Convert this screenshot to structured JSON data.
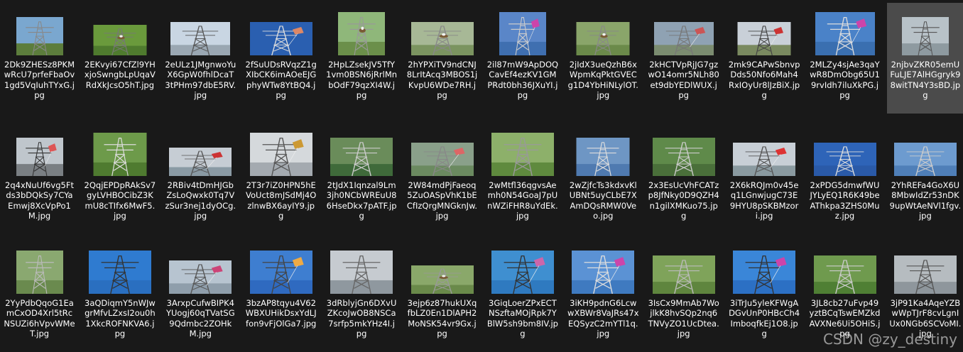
{
  "selected_index": 11,
  "files": [
    {
      "name": "2Dk9ZHESz8PKMwRcU7prfeFbaOv1gd5VqIuhTYxG.jpg",
      "thumb": {
        "sky": "#7aa7cf",
        "ground": "#5c7d3c",
        "tower": "#888",
        "w": 0.75,
        "h": 0.75
      }
    },
    {
      "name": "2EKvyi67CfZl9YHxjoSwngbLpUqaVRdXkJcsO5hT.jpg",
      "thumb": {
        "sky": "#6a9a3c",
        "ground": "#4f7b2e",
        "tower": "#777",
        "nest": true,
        "w": 0.85,
        "h": 0.6
      }
    },
    {
      "name": "2eULz1JMgnwoYuX6GpW0fhlDcaT3tPHm97dbE5RV.jpg",
      "thumb": {
        "sky": "#c9d6e3",
        "ground": "#9aa7b2",
        "tower": "#555",
        "w": 0.95,
        "h": 0.65
      }
    },
    {
      "name": "2fSuUDsRVqzZ1gXIbCK6imAOeEJGphyWTw8YtBQ4.jpg",
      "thumb": {
        "sky": "#2a5fb0",
        "ground": "#2a5fb0",
        "tower": "#ddd",
        "kite": "#d86",
        "w": 1.0,
        "h": 0.65
      }
    },
    {
      "name": "2HpLZsekJV5TfY1vm0BSN6jRrlMnbOdF79qzXI4W.jpg",
      "thumb": {
        "sky": "#8fb77a",
        "ground": "#6b8f4a",
        "tower": "#999",
        "nest": true,
        "w": 0.75,
        "h": 0.85
      }
    },
    {
      "name": "2hYPXiTV9ndCNJ8LrItAcq3MBOS1jKvpU6WDe7RH.jpg",
      "thumb": {
        "sky": "#a7b896",
        "ground": "#7b9460",
        "tower": "#888",
        "nest": true,
        "w": 1.0,
        "h": 0.65
      }
    },
    {
      "name": "2il87mW9ApDOQCavEf4ezKV1GMPRdt0bh36JXuYI.jpg",
      "thumb": {
        "sky": "#5a86c8",
        "ground": "#3f6fb0",
        "tower": "#ccc",
        "kite": "#c4a",
        "w": 0.75,
        "h": 0.85
      }
    },
    {
      "name": "2jIdX3ueQzhB6xWpmKqPktGVECg1D4YbHiNLylOT.jpg",
      "thumb": {
        "sky": "#8aa56a",
        "ground": "#6b8a4a",
        "tower": "#888",
        "nest": true,
        "w": 0.85,
        "h": 0.65
      }
    },
    {
      "name": "2kHCTVpRjJG7gzwO14omr5NLh80et9dbYEDlWUX.jpg",
      "thumb": {
        "sky": "#8fa2b3",
        "ground": "#7b8c70",
        "tower": "#777",
        "kite": "#c55",
        "w": 0.95,
        "h": 0.65
      }
    },
    {
      "name": "2mk9CAPwSbnvpDds50Nfo6Mah4RxIOyUr8lJzBiX.jpg",
      "thumb": {
        "sky": "#c9d0d8",
        "ground": "#7a8a60",
        "tower": "#444",
        "kite": "#c33",
        "w": 0.85,
        "h": 0.65
      }
    },
    {
      "name": "2MLZy4sjAe3qaYwR8DmObg65U19rvIdh7iluXkPG.jpg",
      "thumb": {
        "sky": "#4a82c8",
        "ground": "#3a6fb0",
        "tower": "#ddd",
        "kite": "#c4a",
        "w": 0.95,
        "h": 0.85
      }
    },
    {
      "name": "2njbvZKR05emUFuLJE7AlHGgryk98witTN4Y3sBD.jpg",
      "thumb": {
        "sky": "#b8c2c8",
        "ground": "#8e9aa0",
        "tower": "#555",
        "w": 0.75,
        "h": 0.75
      }
    },
    {
      "name": "2q4xNuUf6vg5Ftds3bDQkSy7CYaEmwj8XcVpPo1M.jpg",
      "thumb": {
        "sky": "#bfc6cc",
        "ground": "#7a7f83",
        "tower": "#333",
        "kite": "#d55",
        "w": 0.75,
        "h": 0.75
      }
    },
    {
      "name": "2QqjEPDpRAkSv7gyLVHBOCibZ3KmU8cTIfx6MwF5.jpg",
      "thumb": {
        "sky": "#6d9a4a",
        "ground": "#4f7b30",
        "tower": "#ddd",
        "w": 0.85,
        "h": 0.85
      }
    },
    {
      "name": "2RBiv4tDmHJGbZsLoQwxk0Tq7VzSur3nej1dyOCg.jpg",
      "thumb": {
        "sky": "#c6cdd4",
        "ground": "#8a9aa4",
        "tower": "#555",
        "kite": "#c33",
        "w": 1.0,
        "h": 0.55
      }
    },
    {
      "name": "2T3r7iZ0HPN5hEVoUct8mJSdMj4OzlnwBX6ayIY9.jpg",
      "thumb": {
        "sky": "#d5d9dc",
        "ground": "#a4aab0",
        "tower": "#555",
        "kite": "#c93",
        "w": 1.0,
        "h": 0.85
      }
    },
    {
      "name": "2tJdX1Iqnzal9Lm3jh0NCbWREuU86HseDkx7pATF.jpg",
      "thumb": {
        "sky": "#6a8c5a",
        "ground": "#3f6a3a",
        "tower": "#ccc",
        "w": 1.0,
        "h": 0.75
      }
    },
    {
      "name": "2W84mdPjFaeoq5ZuOASpVhK1bECfIzQrgMNGknJw.jpg",
      "thumb": {
        "sky": "#8aa08a",
        "ground": "#6b8a60",
        "tower": "#888",
        "kite": "#d66",
        "w": 1.0,
        "h": 0.65
      }
    },
    {
      "name": "2wMtfl36qgvsAemh0N54GoaJ7pUnWZiFHR8uYdEk.jpg",
      "thumb": {
        "sky": "#8db06a",
        "ground": "#5f8a3e",
        "tower": "#999",
        "w": 1.0,
        "h": 0.85
      }
    },
    {
      "name": "2wZjfcTs3kdxvKlUBNt5uyCLbE7XAmDQsRMW0Veo.jpg",
      "thumb": {
        "sky": "#6e96c4",
        "ground": "#4f7ab0",
        "tower": "#ddd",
        "w": 0.85,
        "h": 0.75
      }
    },
    {
      "name": "2x3EsUcVhFCATzp8JfNky0D9QZH4n1gilXMKuo75.jpg",
      "thumb": {
        "sky": "#5f8a4a",
        "ground": "#4a6f3a",
        "tower": "#ccc",
        "w": 1.0,
        "h": 0.75
      }
    },
    {
      "name": "2X6kRQJm0v45eq1LGnwjugC73E9HYU8pSKBMzori.jpg",
      "thumb": {
        "sky": "#c8cfd6",
        "ground": "#8a9aa0",
        "tower": "#555",
        "kite": "#d33",
        "w": 1.0,
        "h": 0.65
      }
    },
    {
      "name": "2xPDG5dmwfWUJYLyEQ1R6K49beAThkpa3ZHS0Muz.jpg",
      "thumb": {
        "sky": "#2e64b8",
        "ground": "#2a5aa8",
        "tower": "#ddd",
        "w": 1.0,
        "h": 0.65
      }
    },
    {
      "name": "2YhREFa4GoX6U8MbwIdZr53nDK9upWtAeNVl1fgv.jpg",
      "thumb": {
        "sky": "#6d9bcf",
        "ground": "#4f7fb8",
        "tower": "#ccc",
        "w": 1.0,
        "h": 0.65
      }
    },
    {
      "name": "2YyPdbQqoG1EamCxOD4Xrl5tRcNSUZi6hVpvWMeT.jpg",
      "thumb": {
        "sky": "#8aa870",
        "ground": "#6a8a4e",
        "tower": "#bbb",
        "w": 0.75,
        "h": 0.85
      }
    },
    {
      "name": "3aQDiqmY5nWJwgrMfvLZxsI2ou0h1XkcROFNKVA6.jpg",
      "thumb": {
        "sky": "#2f7bd0",
        "ground": "#2a6fc0",
        "tower": "#333",
        "w": 1.0,
        "h": 0.85
      }
    },
    {
      "name": "3ArxpCufwBIPK4YUogj60qTVatSG9Qdmbc2ZOHkM.jpg",
      "thumb": {
        "sky": "#b7c4d0",
        "ground": "#8f9eab",
        "tower": "#555",
        "kite": "#c47",
        "w": 1.0,
        "h": 0.65
      }
    },
    {
      "name": "3bzAP8tqyu4V62WBXUHikDsxYdLJfon9vFjOlGa7.jpg",
      "thumb": {
        "sky": "#3e7ed0",
        "ground": "#2f6ac0",
        "tower": "#444",
        "kite": "#ea4",
        "w": 1.0,
        "h": 0.85
      }
    },
    {
      "name": "3dRblyjGn6DXvUZKcoJwOB8NSCa7srfp5mkYHz4I.jpg",
      "thumb": {
        "sky": "#c6cbd0",
        "ground": "#8f989f",
        "tower": "#666",
        "w": 1.0,
        "h": 0.85
      }
    },
    {
      "name": "3ejp6z87hukUXqfbLZ0En1DlAPH2MoNSK54vr9Gx.jpg",
      "thumb": {
        "sky": "#8aa86a",
        "ground": "#6a8a4a",
        "tower": "#999",
        "nest": true,
        "w": 1.0,
        "h": 0.55
      }
    },
    {
      "name": "3GiqLoerZPxECTNSzftaMOjRpk7YBlW5sh9bm8IV.jpg",
      "thumb": {
        "sky": "#3f8fd0",
        "ground": "#2f7ac0",
        "tower": "#333",
        "kite": "#c6a",
        "w": 1.0,
        "h": 0.85
      }
    },
    {
      "name": "3iKH9pdnG6LcwwXBWr8VaJRs47xEQSyzC2mYTl1q.jpg",
      "thumb": {
        "sky": "#5b92d4",
        "ground": "#3f7ac0",
        "tower": "#ddd",
        "kite": "#c4a",
        "w": 1.0,
        "h": 0.85
      }
    },
    {
      "name": "3IsCx9MmAb7WojlkK8hvSQp2nq6TNVyZO1UcDtea.jpg",
      "thumb": {
        "sky": "#7fa35a",
        "ground": "#5f853e",
        "tower": "#bbb",
        "w": 1.0,
        "h": 0.75
      }
    },
    {
      "name": "3iTrJu5yleKFWgADGvUnP0HBcCh4ImboqfkEj1O8.jpg",
      "thumb": {
        "sky": "#3a86d8",
        "ground": "#2c70c4",
        "tower": "#333",
        "kite": "#c4a",
        "w": 1.0,
        "h": 0.85
      }
    },
    {
      "name": "3JL8cb27uFvp49yztBCqTswEMZkdAVXNe6Ui5OHiS.jpg",
      "thumb": {
        "sky": "#6f9a4e",
        "ground": "#4f7f34",
        "tower": "#ccc",
        "w": 1.0,
        "h": 0.75
      }
    },
    {
      "name": "3jP91Ka4AqeYZBwWpTJrF8cvLgnIUx0NGb6SCVoMI.jpg",
      "thumb": {
        "sky": "#b6bcc0",
        "ground": "#8e969c",
        "tower": "#555",
        "w": 1.0,
        "h": 0.75
      }
    }
  ],
  "watermark": "CSDN @zy_destiny"
}
